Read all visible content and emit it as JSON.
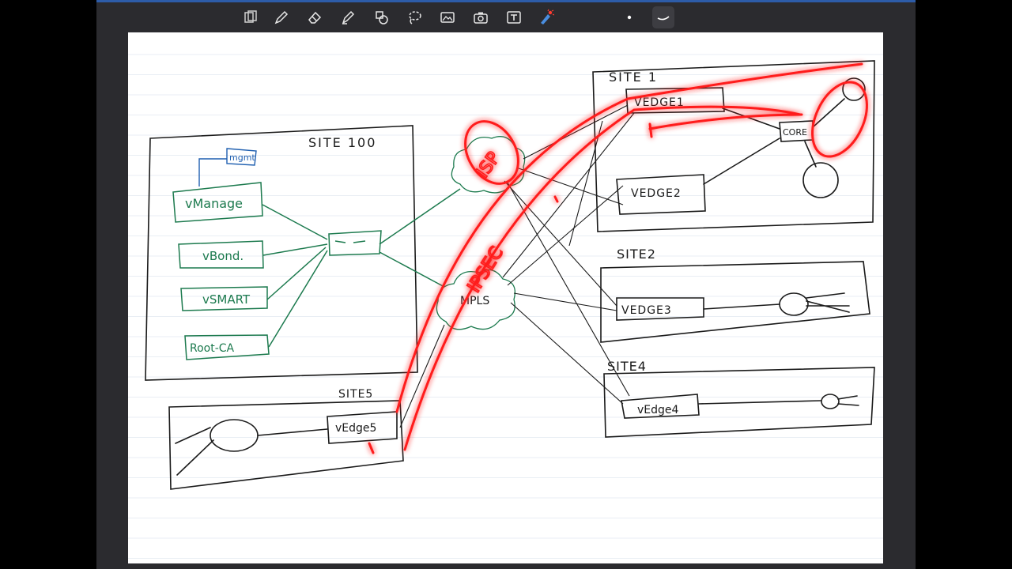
{
  "toolbar": {
    "tools": [
      {
        "name": "page-layout-icon"
      },
      {
        "name": "pen-icon"
      },
      {
        "name": "eraser-icon"
      },
      {
        "name": "highlighter-icon"
      },
      {
        "name": "shapes-icon"
      },
      {
        "name": "lasso-icon"
      },
      {
        "name": "image-icon"
      },
      {
        "name": "camera-icon"
      },
      {
        "name": "text-box-icon"
      },
      {
        "name": "laser-pointer-icon"
      }
    ],
    "pen_colors": {
      "dot": "#ffffff",
      "stroke": "#ffffff"
    }
  },
  "colors": {
    "accent_bar": "#2d5ca8",
    "ink_black": "#1a1a1a",
    "ink_green": "#1c7a4e",
    "ink_blue": "#1f5fb0",
    "laser_red": "#ff1a1a",
    "ruled_lines": "#e9eef4"
  },
  "diagram": {
    "site100": {
      "label": "SITE 100"
    },
    "controllers": {
      "mgmt": "mgmt",
      "vmanage": "vManage",
      "vbond": "vBond.",
      "vsmart": "vSMART",
      "rootca": "Root-CA"
    },
    "site1": {
      "label": "SITE 1",
      "vedge1": "VEDGE1",
      "vedge2": "VEDGE2",
      "core": "CORE"
    },
    "site2": {
      "label": "SITE2",
      "vedge3": "VEDGE3"
    },
    "site4": {
      "label": "SITE4",
      "vedge": "vEdge4"
    },
    "site5": {
      "label": "SITE5",
      "vedge": "vEdge5"
    },
    "clouds": {
      "isp": "ISP",
      "mpls": "MPLS"
    },
    "annotation": {
      "ipsec": "IPSEC"
    }
  }
}
